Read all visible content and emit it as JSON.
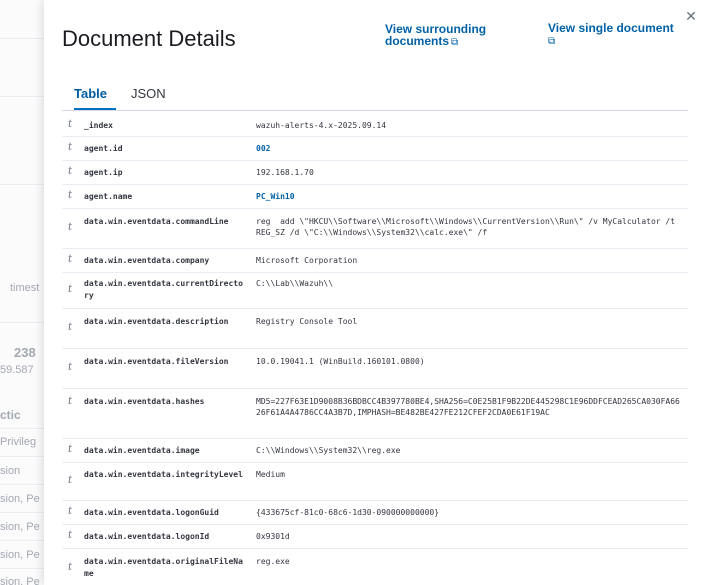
{
  "background": {
    "timestamp_label": "timest",
    "count_text": "238",
    "time_text": "59.587",
    "tactic_label": "ctic",
    "rows": [
      "Privileg",
      "sion",
      "sion, Pe",
      "sion, Pe",
      "sion, Pe",
      "sion, Pe"
    ]
  },
  "flyout": {
    "title": "Document Details",
    "link_surrounding": "View surrounding documents",
    "link_single": "View single document",
    "close_icon": "close-icon",
    "tabs": [
      {
        "label": "Table",
        "active": true
      },
      {
        "label": "JSON",
        "active": false
      }
    ]
  },
  "fields": [
    {
      "type": "t",
      "name": "_index",
      "value": "wazuh-alerts-4.x-2025.09.14"
    },
    {
      "type": "t",
      "name": "agent.id",
      "value": "002"
    },
    {
      "type": "t",
      "name": "agent.ip",
      "value": "192.168.1.70"
    },
    {
      "type": "t",
      "name": "agent.name",
      "value": "PC_Win10"
    },
    {
      "type": "t",
      "name": "data.win.eventdata.commandLine",
      "value": "reg  add \\\"HKCU\\\\Software\\\\Microsoft\\\\Windows\\\\CurrentVersion\\\\Run\\\" /v MyCalculator /t REG_SZ /d \\\"C:\\\\Windows\\\\System32\\\\calc.exe\\\" /f"
    },
    {
      "type": "t",
      "name": "data.win.eventdata.company",
      "value": "Microsoft Corporation"
    },
    {
      "type": "t",
      "name": "data.win.eventdata.currentDirectory",
      "value": "C:\\\\Lab\\\\Wazuh\\\\"
    },
    {
      "type": "t",
      "name": "data.win.eventdata.description",
      "value": "Registry Console Tool"
    },
    {
      "type": "t",
      "name": "data.win.eventdata.fileVersion",
      "value": "10.0.19041.1 (WinBuild.160101.0800)"
    },
    {
      "type": "t",
      "name": "data.win.eventdata.hashes",
      "value": "MD5=227F63E1D9008B36BDBCC4B397780BE4,SHA256=C0E25B1F9B22DE445298C1E96DDFCEAD265CA030FA6626F61A4A4786CC4A3B7D,IMPHASH=BE482BE427FE212CFEF2CDA0E61F19AC"
    },
    {
      "type": "t",
      "name": "data.win.eventdata.image",
      "value": "C:\\\\Windows\\\\System32\\\\reg.exe"
    },
    {
      "type": "t",
      "name": "data.win.eventdata.integrityLevel",
      "value": "Medium"
    },
    {
      "type": "t",
      "name": "data.win.eventdata.logonGuid",
      "value": "{433675cf-81c0-68c6-1d30-090000000000}"
    },
    {
      "type": "t",
      "name": "data.win.eventdata.logonId",
      "value": "0x9301d"
    },
    {
      "type": "t",
      "name": "data.win.eventdata.originalFileName",
      "value": "reg.exe"
    }
  ]
}
